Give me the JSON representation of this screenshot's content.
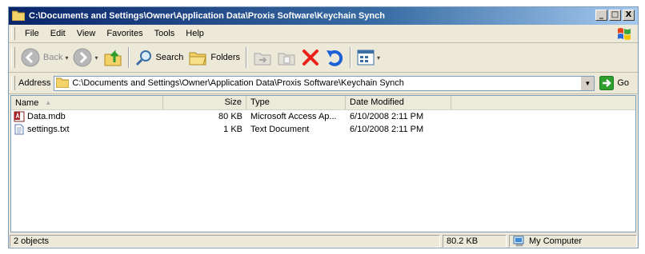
{
  "window": {
    "title": "C:\\Documents and Settings\\Owner\\Application Data\\Proxis Software\\Keychain Synch",
    "buttons": {
      "minimize": "_",
      "maximize": "□",
      "close": "X"
    }
  },
  "menubar": {
    "items": [
      "File",
      "Edit",
      "View",
      "Favorites",
      "Tools",
      "Help"
    ]
  },
  "toolbar": {
    "back_label": "Back",
    "search_label": "Search",
    "folders_label": "Folders"
  },
  "address": {
    "label": "Address",
    "value": "C:\\Documents and Settings\\Owner\\Application Data\\Proxis Software\\Keychain Synch",
    "go_label": "Go"
  },
  "filelist": {
    "columns": {
      "name": "Name",
      "size": "Size",
      "type": "Type",
      "date": "Date Modified"
    },
    "rows": [
      {
        "name": "Data.mdb",
        "size": "80 KB",
        "type": "Microsoft Access Ap...",
        "date": "6/10/2008 2:11 PM",
        "icon": "access-db-icon"
      },
      {
        "name": "settings.txt",
        "size": "1 KB",
        "type": "Text Document",
        "date": "6/10/2008 2:11 PM",
        "icon": "text-file-icon"
      }
    ]
  },
  "statusbar": {
    "objects": "2 objects",
    "size": "80.2 KB",
    "zone": "My Computer"
  },
  "colors": {
    "titlebar_start": "#0a246a",
    "titlebar_end": "#a6caf0",
    "window_face": "#ece9d8",
    "delete_red": "#e8231b",
    "go_green": "#2e9e2e"
  }
}
